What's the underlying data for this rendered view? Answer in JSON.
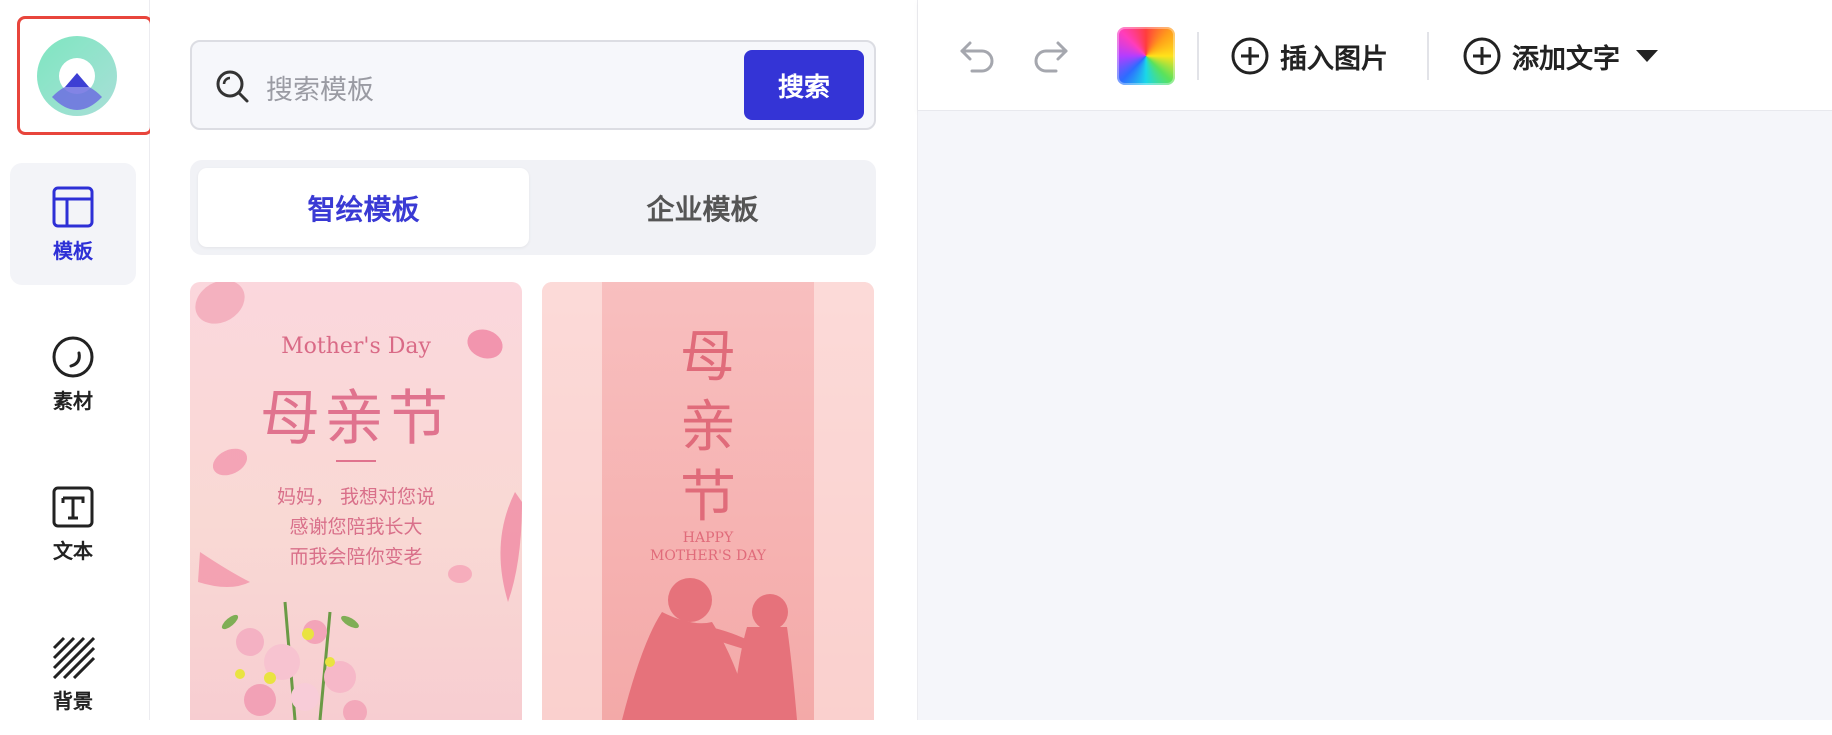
{
  "sidebar": {
    "items": [
      {
        "label": "模板",
        "icon": "template-layout-icon",
        "active": true
      },
      {
        "label": "素材",
        "icon": "material-circle-icon",
        "active": false
      },
      {
        "label": "文本",
        "icon": "text-box-icon",
        "active": false
      },
      {
        "label": "背景",
        "icon": "background-hatch-icon",
        "active": false
      }
    ]
  },
  "search": {
    "placeholder": "搜索模板",
    "button_label": "搜索"
  },
  "tabs": [
    {
      "label": "智绘模板",
      "active": true
    },
    {
      "label": "企业模板",
      "active": false
    }
  ],
  "templates": [
    {
      "title_en": "Mother's Day",
      "title_cn": "母亲节",
      "lines": [
        "妈妈， 我想对您说",
        "感谢您陪我长大",
        "而我会陪你变老"
      ]
    },
    {
      "title_cn_chars": [
        "母",
        "亲",
        "节"
      ],
      "title_en_lines": [
        "HAPPY",
        "MOTHER'S DAY"
      ]
    }
  ],
  "toolbar": {
    "insert_image_label": "插入图片",
    "add_text_label": "添加文字"
  },
  "colors": {
    "accent": "#3434d6",
    "highlight_border": "#e8453c",
    "canvas_bg": "#f5f6fa"
  }
}
